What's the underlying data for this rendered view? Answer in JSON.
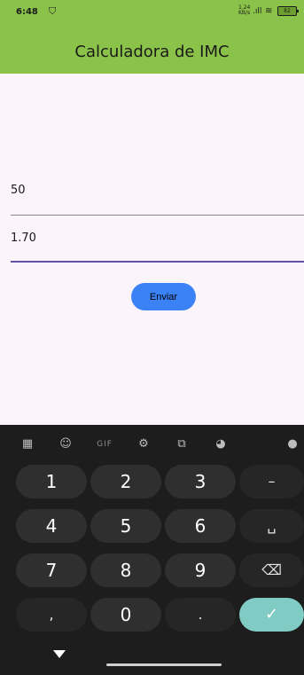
{
  "status_bar": {
    "time": "6:48",
    "notification_icon": "shield-icon",
    "network_speed_top": "1.24",
    "network_speed_bottom": "KB/s",
    "signal_text": ".ıll",
    "wifi_icon": "wifi-icon",
    "battery_level": "82"
  },
  "app_bar": {
    "title": "Calculadora de IMC",
    "background": "#8bc34a"
  },
  "form": {
    "weight_value": "50",
    "height_value": "1.70",
    "submit_label": "Enviar",
    "button_color": "#3b82f6"
  },
  "keyboard": {
    "toolbar": [
      {
        "name": "apps-icon",
        "glyph": "▦"
      },
      {
        "name": "sticker-icon",
        "glyph": "☺"
      },
      {
        "name": "gif-button",
        "glyph": "GIF"
      },
      {
        "name": "settings-icon",
        "glyph": "⚙"
      },
      {
        "name": "translate-icon",
        "glyph": "⧉"
      },
      {
        "name": "palette-icon",
        "glyph": "◕"
      },
      {
        "name": "mic-icon",
        "glyph": "🎤"
      }
    ],
    "keys": {
      "k1": "1",
      "k2": "2",
      "k3": "3",
      "minus": "–",
      "k4": "4",
      "k5": "5",
      "k6": "6",
      "space": "␣",
      "k7": "7",
      "k8": "8",
      "k9": "9",
      "backspace": "⌫",
      "comma": ",",
      "k0": "0",
      "period": ".",
      "done": "✓"
    },
    "done_color": "#80cbc4"
  },
  "navigation": {
    "back_icon": "back-triangle-icon",
    "home_icon": "home-handle"
  }
}
